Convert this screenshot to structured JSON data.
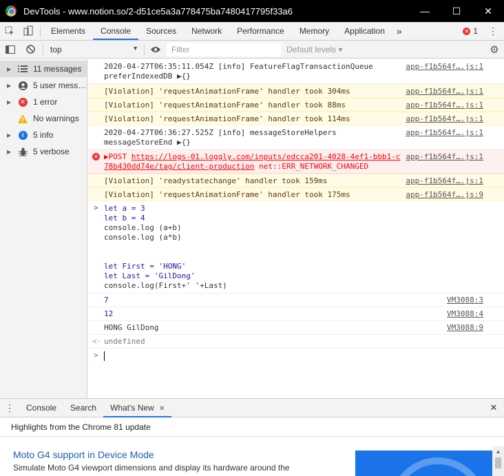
{
  "window": {
    "title": "DevTools - www.notion.so/2-d51ce5a3a778475ba7480417795f33a6",
    "minimize": "—",
    "maximize": "☐",
    "close": "✕"
  },
  "tabs": [
    "Elements",
    "Console",
    "Sources",
    "Network",
    "Performance",
    "Memory",
    "Application"
  ],
  "more_tabs": "»",
  "error_count": "1",
  "toolbar": {
    "context": "top",
    "filter_placeholder": "Filter",
    "levels": "Default levels ▾"
  },
  "sidebar": {
    "items": [
      {
        "label": "11 messages",
        "icon": "list-icon"
      },
      {
        "count": "5",
        "label": "user mess…",
        "icon": "user-icon"
      },
      {
        "label": "1 error",
        "icon": "error-icon"
      },
      {
        "label": "No warnings",
        "icon": "warning-icon"
      },
      {
        "count": "5",
        "label": "info",
        "icon": "info-icon"
      },
      {
        "count": "5",
        "label": "verbose",
        "icon": "verbose-icon"
      }
    ]
  },
  "console": {
    "messages": [
      {
        "type": "info",
        "text": "2020-04-27T06:35:11.054Z [info] FeatureFlagTransactionQueue\npreferIndexedDB ▶{}",
        "source": "app-f1b564f….js:1"
      },
      {
        "type": "warn",
        "text": "[Violation] 'requestAnimationFrame' handler took 304ms",
        "source": "app-f1b564f….js:1"
      },
      {
        "type": "warn",
        "text": "[Violation] 'requestAnimationFrame' handler took 88ms",
        "source": "app-f1b564f….js:1"
      },
      {
        "type": "warn",
        "text": "[Violation] 'requestAnimationFrame' handler took 114ms",
        "source": "app-f1b564f….js:1"
      },
      {
        "type": "info",
        "text": "2020-04-27T06:36:27.525Z [info] messageStoreHelpers\nmessageStoreEnd ▶{}",
        "source": "app-f1b564f….js:1"
      },
      {
        "type": "error",
        "prefix": "▶POST ",
        "url": "https://logs-01.loggly.com/inputs/edcca201-4028-4ef1-bbb1-c",
        "url2": "78b430dd74e/tag/client-production",
        "suffix": " net::ERR_NETWORK_CHANGED",
        "source": "app-f1b564f….js:1"
      },
      {
        "type": "warn",
        "text": "[Violation] 'readystatechange' handler took 159ms",
        "source": "app-f1b564f….js:1"
      },
      {
        "type": "warn",
        "text": "[Violation] 'requestAnimationFrame' handler took 175ms",
        "source": "app-f1b564f….js:9"
      }
    ],
    "input_block": {
      "prompt": ">",
      "lines": [
        "let a = 3",
        "let b = 4",
        "console.log (a+b)",
        "console.log (a*b)",
        "",
        "",
        "let First = 'HONG'",
        "let Last = 'GilDong'",
        "console.log(First+' '+Last)"
      ]
    },
    "outputs": [
      {
        "text": "7",
        "source": "VM3088:3"
      },
      {
        "text": "12",
        "source": "VM3088:4"
      },
      {
        "text": "HONG GilDong",
        "source": "VM3088:9"
      }
    ],
    "result_prompt": "<·",
    "result": "undefined",
    "input_prompt": ">"
  },
  "drawer": {
    "tabs": [
      "Console",
      "Search",
      "What's New"
    ],
    "close": "✕",
    "highlights": "Highlights from the Chrome 81 update",
    "item_title": "Moto G4 support in Device Mode",
    "item_desc": "Simulate Moto G4 viewport dimensions and display its hardware around the"
  },
  "colors": {
    "accent": "#1a73e8",
    "warning_bg": "#fffbe6",
    "error_bg": "#fff0f0",
    "error_text": "#ff0000"
  }
}
